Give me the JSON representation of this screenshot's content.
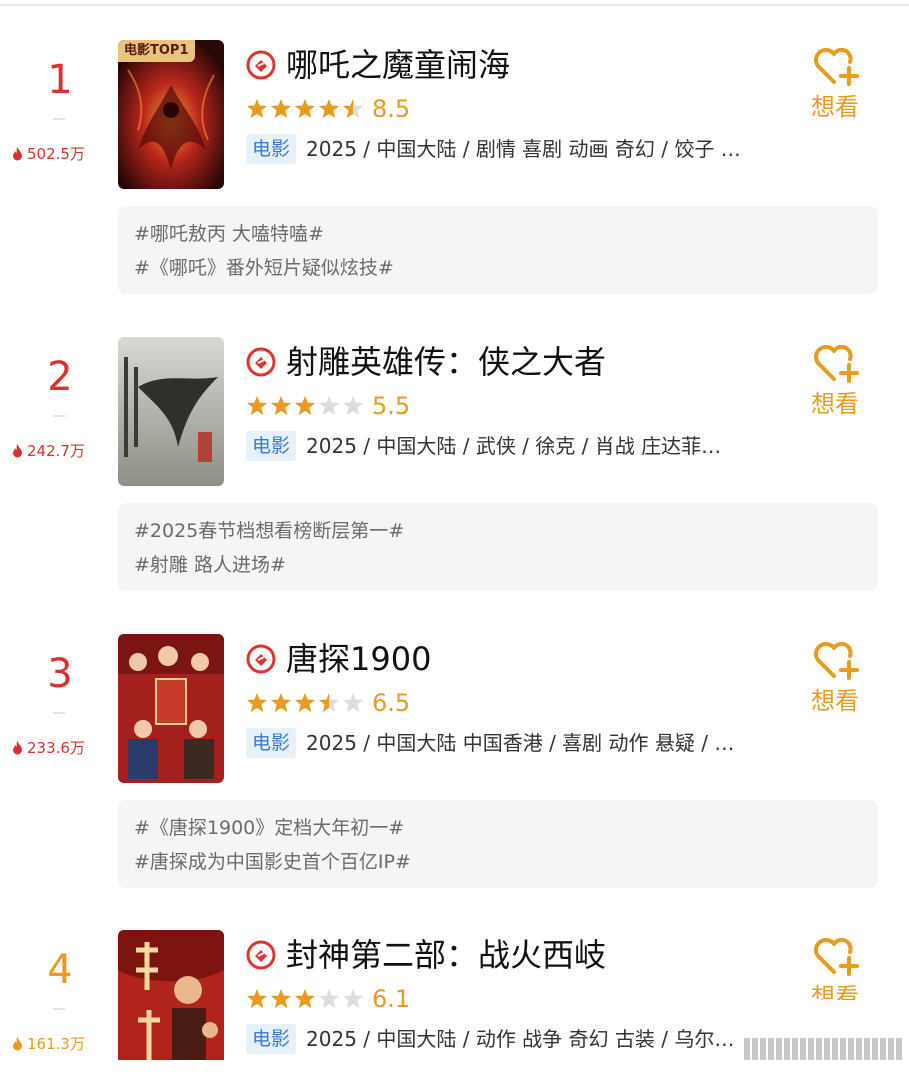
{
  "colors": {
    "rank_red": "#d8312f",
    "rank_gold": "#e89b1e",
    "accent_orange": "#e89b1e",
    "badge_blue_text": "#3b7bd2",
    "badge_blue_bg": "#e7f1fa",
    "topic_bg": "#f5f5f5"
  },
  "items": [
    {
      "rank": "1",
      "heat": "502.5万",
      "poster_badge": "电影TOP1",
      "title": "哪吒之魔童闹海",
      "stars": 4.5,
      "score": "8.5",
      "type": "电影",
      "meta": "2025 / 中国大陆 / 剧情 喜剧 动画 奇幻 / 饺子 …",
      "want_label": "想看",
      "topics": [
        "#哪吒敖丙 大嗑特嗑#",
        "#《哪吒》番外短片疑似炫技#"
      ]
    },
    {
      "rank": "2",
      "heat": "242.7万",
      "title": "射雕英雄传：侠之大者",
      "stars": 3,
      "score": "5.5",
      "type": "电影",
      "meta": "2025 / 中国大陆 / 武侠 / 徐克 / 肖战 庄达菲…",
      "want_label": "想看",
      "topics": [
        "#2025春节档想看榜断层第一#",
        "#射雕 路人进场#"
      ]
    },
    {
      "rank": "3",
      "heat": "233.6万",
      "title": "唐探1900",
      "stars": 3.5,
      "score": "6.5",
      "type": "电影",
      "meta": "2025 / 中国大陆 中国香港 / 喜剧 动作 悬疑 / …",
      "want_label": "想看",
      "topics": [
        "#《唐探1900》定档大年初一#",
        "#唐探成为中国影史首个百亿IP#"
      ]
    },
    {
      "rank": "4",
      "heat": "161.3万",
      "title": "封神第二部：战火西岐",
      "stars": 3,
      "score": "6.1",
      "type": "电影",
      "meta": "2025 / 中国大陆 / 动作 战争 奇幻 古装 / 乌尔…",
      "want_label": "想看"
    }
  ],
  "icons": {
    "heat": "flame-icon",
    "title_prefix": "certified-play-icon",
    "want": "heart-plus-icon",
    "rating": "star-icon"
  }
}
